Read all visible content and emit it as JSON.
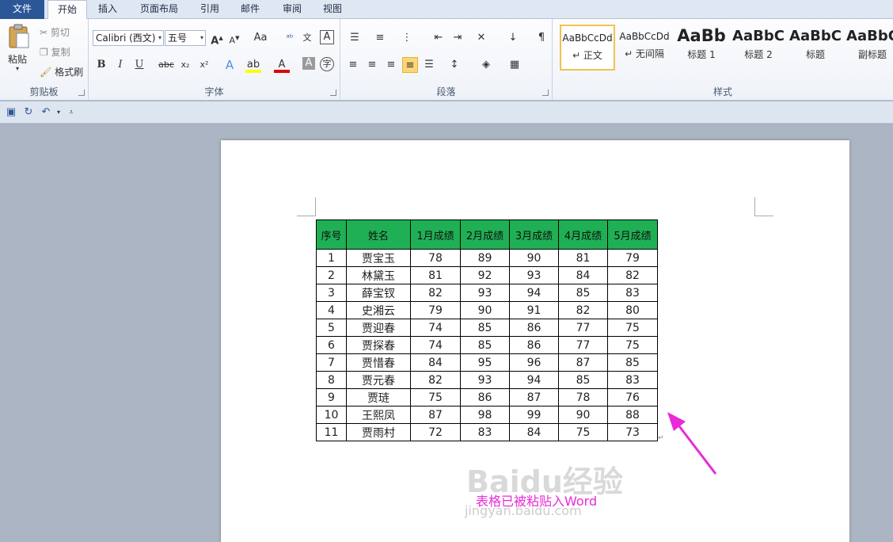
{
  "tabs": {
    "file": "文件",
    "home": "开始",
    "insert": "插入",
    "page_layout": "页面布局",
    "references": "引用",
    "mailings": "邮件",
    "review": "审阅",
    "view": "视图"
  },
  "clipboard": {
    "paste": "粘贴",
    "cut": "剪切",
    "copy": "复制",
    "format_painter": "格式刷",
    "label": "剪贴板"
  },
  "font": {
    "name": "Calibri (西文)",
    "size": "五号",
    "change_case": "Aa",
    "label": "字体",
    "bold": "B",
    "italic": "I",
    "underline": "U",
    "strike": "abc",
    "sub": "x₂",
    "sup": "x²"
  },
  "paragraph": {
    "label": "段落"
  },
  "styles": {
    "label": "样式",
    "items": [
      {
        "sample": "AaBbCcDd",
        "name": "↵ 正文"
      },
      {
        "sample": "AaBbCcDd",
        "name": "↵ 无间隔"
      },
      {
        "sample": "AaBb",
        "name": "标题 1"
      },
      {
        "sample": "AaBbC",
        "name": "标题 2"
      },
      {
        "sample": "AaBbC",
        "name": "标题"
      },
      {
        "sample": "AaBbC",
        "name": "副标题"
      }
    ]
  },
  "table": {
    "headers": [
      "序号",
      "姓名",
      "1月成绩",
      "2月成绩",
      "3月成绩",
      "4月成绩",
      "5月成绩"
    ],
    "rows": [
      [
        "1",
        "贾宝玉",
        "78",
        "89",
        "90",
        "81",
        "79"
      ],
      [
        "2",
        "林黛玉",
        "81",
        "92",
        "93",
        "84",
        "82"
      ],
      [
        "3",
        "薛宝钗",
        "82",
        "93",
        "94",
        "85",
        "83"
      ],
      [
        "4",
        "史湘云",
        "79",
        "90",
        "91",
        "82",
        "80"
      ],
      [
        "5",
        "贾迎春",
        "74",
        "85",
        "86",
        "77",
        "75"
      ],
      [
        "6",
        "贾探春",
        "74",
        "85",
        "86",
        "77",
        "75"
      ],
      [
        "7",
        "贾惜春",
        "84",
        "95",
        "96",
        "87",
        "85"
      ],
      [
        "8",
        "贾元春",
        "82",
        "93",
        "94",
        "85",
        "83"
      ],
      [
        "9",
        "贾琏",
        "75",
        "86",
        "87",
        "78",
        "76"
      ],
      [
        "10",
        "王熙凤",
        "87",
        "98",
        "99",
        "90",
        "88"
      ],
      [
        "11",
        "贾雨村",
        "72",
        "83",
        "84",
        "75",
        "73"
      ]
    ],
    "header_color": "#1fb055"
  },
  "annotation": {
    "text": "表格已被粘贴入Word",
    "color": "#e82ad8",
    "watermark": "Baidu经验",
    "watermark_url": "jingyan.baidu.com"
  }
}
